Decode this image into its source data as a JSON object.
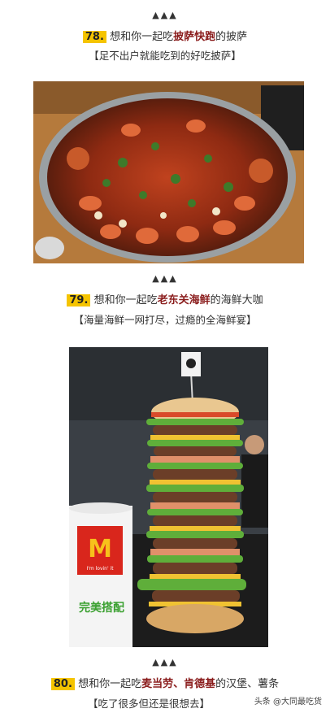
{
  "items": [
    {
      "marker": "▲▲▲",
      "number": "78.",
      "pre": "想和你一起吃",
      "highlight": "披萨快跑",
      "post": "的披萨",
      "subtitle": "【足不出户就能吃到的好吃披萨】"
    },
    {
      "marker": "▲▲▲",
      "number": "79.",
      "pre": "想和你一起吃",
      "highlight": "老东关海鲜",
      "post": "的海鲜大咖",
      "subtitle": "【海量海鲜一网打尽，过瘾的全海鲜宴】"
    },
    {
      "marker": "▲▲▲",
      "number": "80.",
      "pre": "想和你一起吃",
      "highlight": "麦当劳、肯德基",
      "post": "的汉堡、薯条",
      "subtitle": "【吃了很多但还是很想去】"
    }
  ],
  "images": {
    "seafood_pot": "seafood-pot-photo",
    "burger_tower": "burger-tower-photo"
  },
  "cup_text": {
    "m_logo": "M",
    "brand": "I'm lovin' it",
    "slogan": "完美搭配"
  },
  "watermark": "头条 @大同最吃货"
}
